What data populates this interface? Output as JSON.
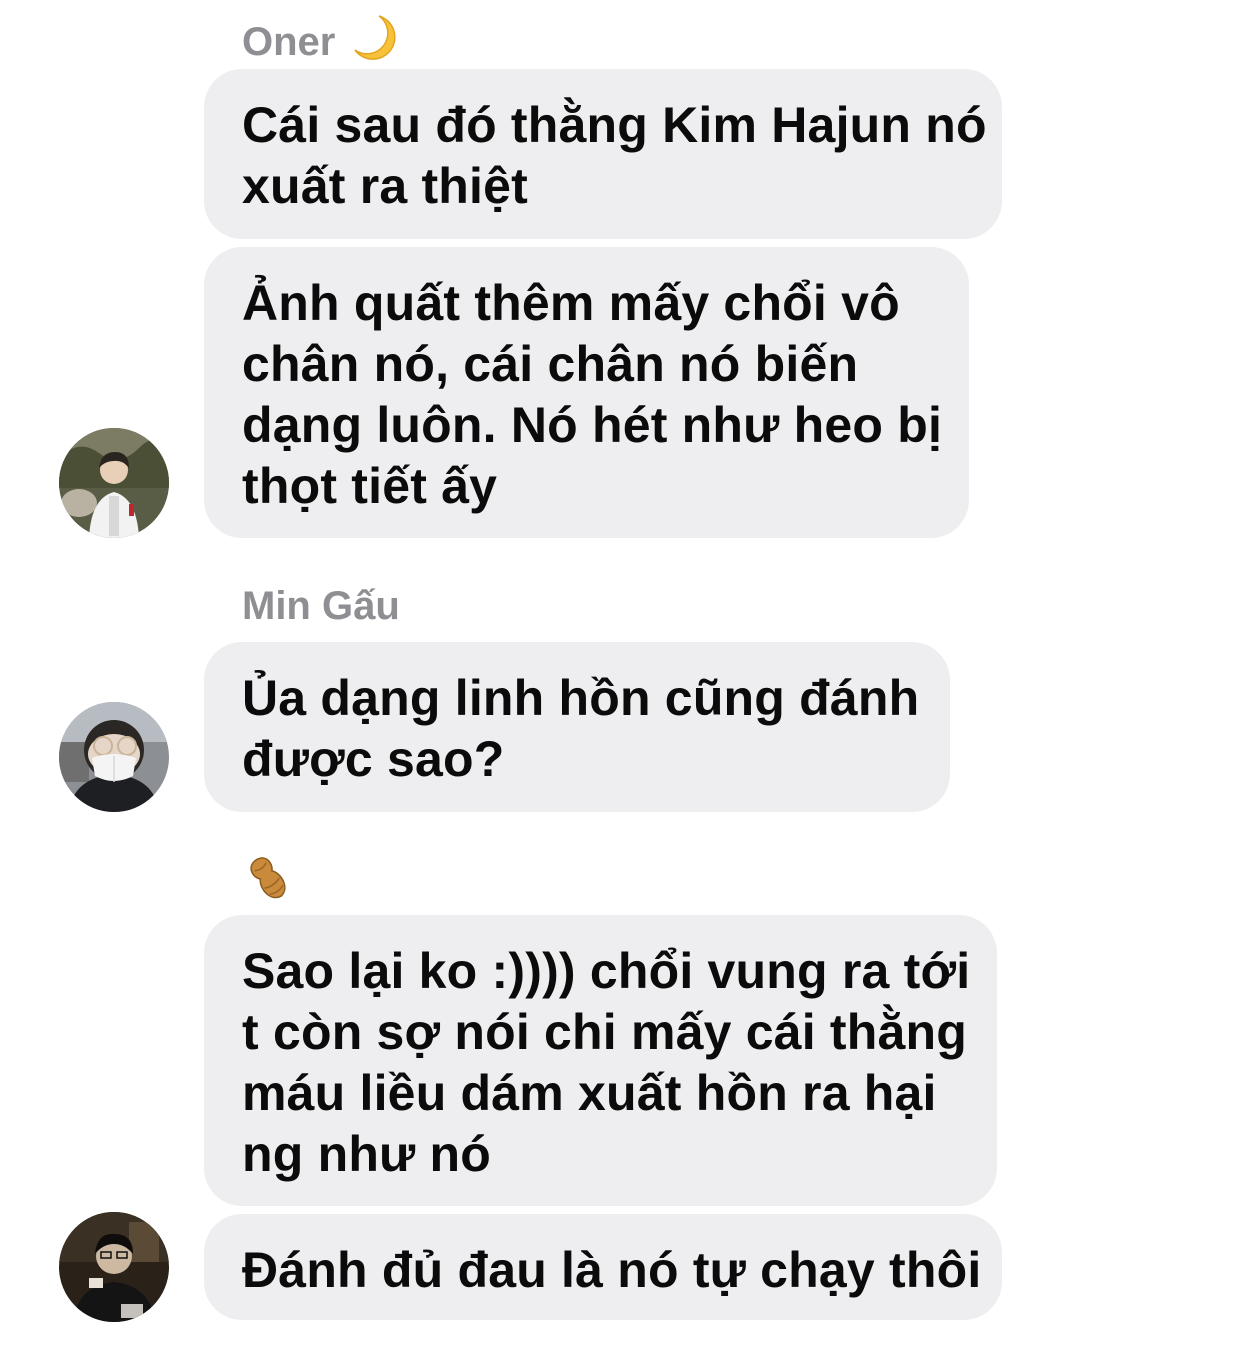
{
  "groups": [
    {
      "sender": "Oner",
      "sender_emoji": "moon-icon",
      "messages": [
        {
          "lines": [
            "Cái sau đó thằng Kim Hajun nó",
            "xuất ra thiệt"
          ]
        },
        {
          "lines": [
            "Ảnh quất thêm mấy chổi vô",
            "chân nó, cái chân nó biến",
            "dạng luôn. Nó hét như heo bị",
            "thọt tiết ấy"
          ]
        }
      ]
    },
    {
      "sender": "Min Gấu",
      "messages": [
        {
          "lines": [
            "Ủa dạng linh hồn cũng đánh",
            "được sao?"
          ]
        }
      ]
    },
    {
      "sender": "",
      "sender_emoji": "peanut-icon",
      "messages": [
        {
          "lines": [
            "Sao lại ko :)))) chổi vung ra tới",
            "t còn sợ nói chi mấy cái thằng",
            "máu liều dám xuất hồn ra hại",
            "ng như nó"
          ]
        },
        {
          "lines": [
            "Đánh đủ đau là nó tự chạy thôi"
          ]
        }
      ]
    }
  ],
  "colors": {
    "bubble": "#eeeef0",
    "sender_name": "#8e8e93",
    "text": "#0b0b0b",
    "moon": "#f7c23a",
    "peanut": "#c98a3c"
  }
}
